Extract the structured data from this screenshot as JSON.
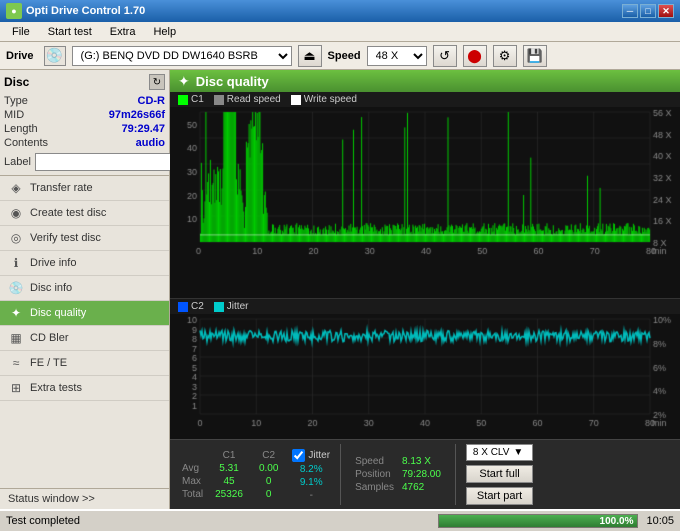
{
  "app": {
    "title": "Opti Drive Control 1.70",
    "icon": "●"
  },
  "titlebar": {
    "minimize": "─",
    "maximize": "□",
    "close": "✕"
  },
  "menu": {
    "items": [
      "File",
      "Start test",
      "Extra",
      "Help"
    ]
  },
  "drive": {
    "label": "Drive",
    "select_value": "(G:)  BENQ DVD DD DW1640 BSRB",
    "speed_label": "Speed",
    "speed_value": "48 X"
  },
  "disc": {
    "title": "Disc",
    "type_label": "Type",
    "type_value": "CD-R",
    "mid_label": "MID",
    "mid_value": "97m26s66f",
    "length_label": "Length",
    "length_value": "79:29.47",
    "contents_label": "Contents",
    "contents_value": "audio",
    "label_label": "Label",
    "label_value": ""
  },
  "nav": {
    "items": [
      {
        "id": "transfer-rate",
        "label": "Transfer rate",
        "icon": "◈"
      },
      {
        "id": "create-test-disc",
        "label": "Create test disc",
        "icon": "◉"
      },
      {
        "id": "verify-test-disc",
        "label": "Verify test disc",
        "icon": "◎"
      },
      {
        "id": "drive-info",
        "label": "Drive info",
        "icon": "ℹ"
      },
      {
        "id": "disc-info",
        "label": "Disc info",
        "icon": "📀"
      },
      {
        "id": "disc-quality",
        "label": "Disc quality",
        "icon": "✦",
        "active": true
      },
      {
        "id": "cd-bler",
        "label": "CD Bler",
        "icon": "▦"
      },
      {
        "id": "fe-te",
        "label": "FE / TE",
        "icon": "≈"
      },
      {
        "id": "extra-tests",
        "label": "Extra tests",
        "icon": "⊞"
      }
    ]
  },
  "chart": {
    "title": "Disc quality",
    "legend": {
      "c1_color": "#00ff00",
      "c2_color": "#0080ff",
      "c1_label": "C1",
      "c2_label": "Read speed",
      "c3_label": "Write speed"
    },
    "upper": {
      "y_max": 56,
      "y_label": "X",
      "x_max": 80,
      "x_label": "min"
    },
    "lower": {
      "c2_label": "C2",
      "jitter_label": "Jitter",
      "jitter_color": "#00cccc",
      "y_max": 10,
      "y_label": "10%"
    }
  },
  "stats": {
    "headers": [
      "",
      "C1",
      "C2"
    ],
    "avg_label": "Avg",
    "avg_c1": "5.31",
    "avg_c2": "0.00",
    "avg_jitter": "8.2%",
    "max_label": "Max",
    "max_c1": "45",
    "max_c2": "0",
    "max_jitter": "9.1%",
    "total_label": "Total",
    "total_c1": "25326",
    "total_c2": "0",
    "jitter_label": "Jitter",
    "speed_label": "Speed",
    "speed_value": "8.13 X",
    "speed_mode": "8 X CLV",
    "position_label": "Position",
    "position_value": "79:28.00",
    "samples_label": "Samples",
    "samples_value": "4762",
    "btn_full": "Start full",
    "btn_part": "Start part"
  },
  "statusbar": {
    "text": "Test completed",
    "progress": 100,
    "progress_text": "100.0%",
    "time": "10:05"
  }
}
